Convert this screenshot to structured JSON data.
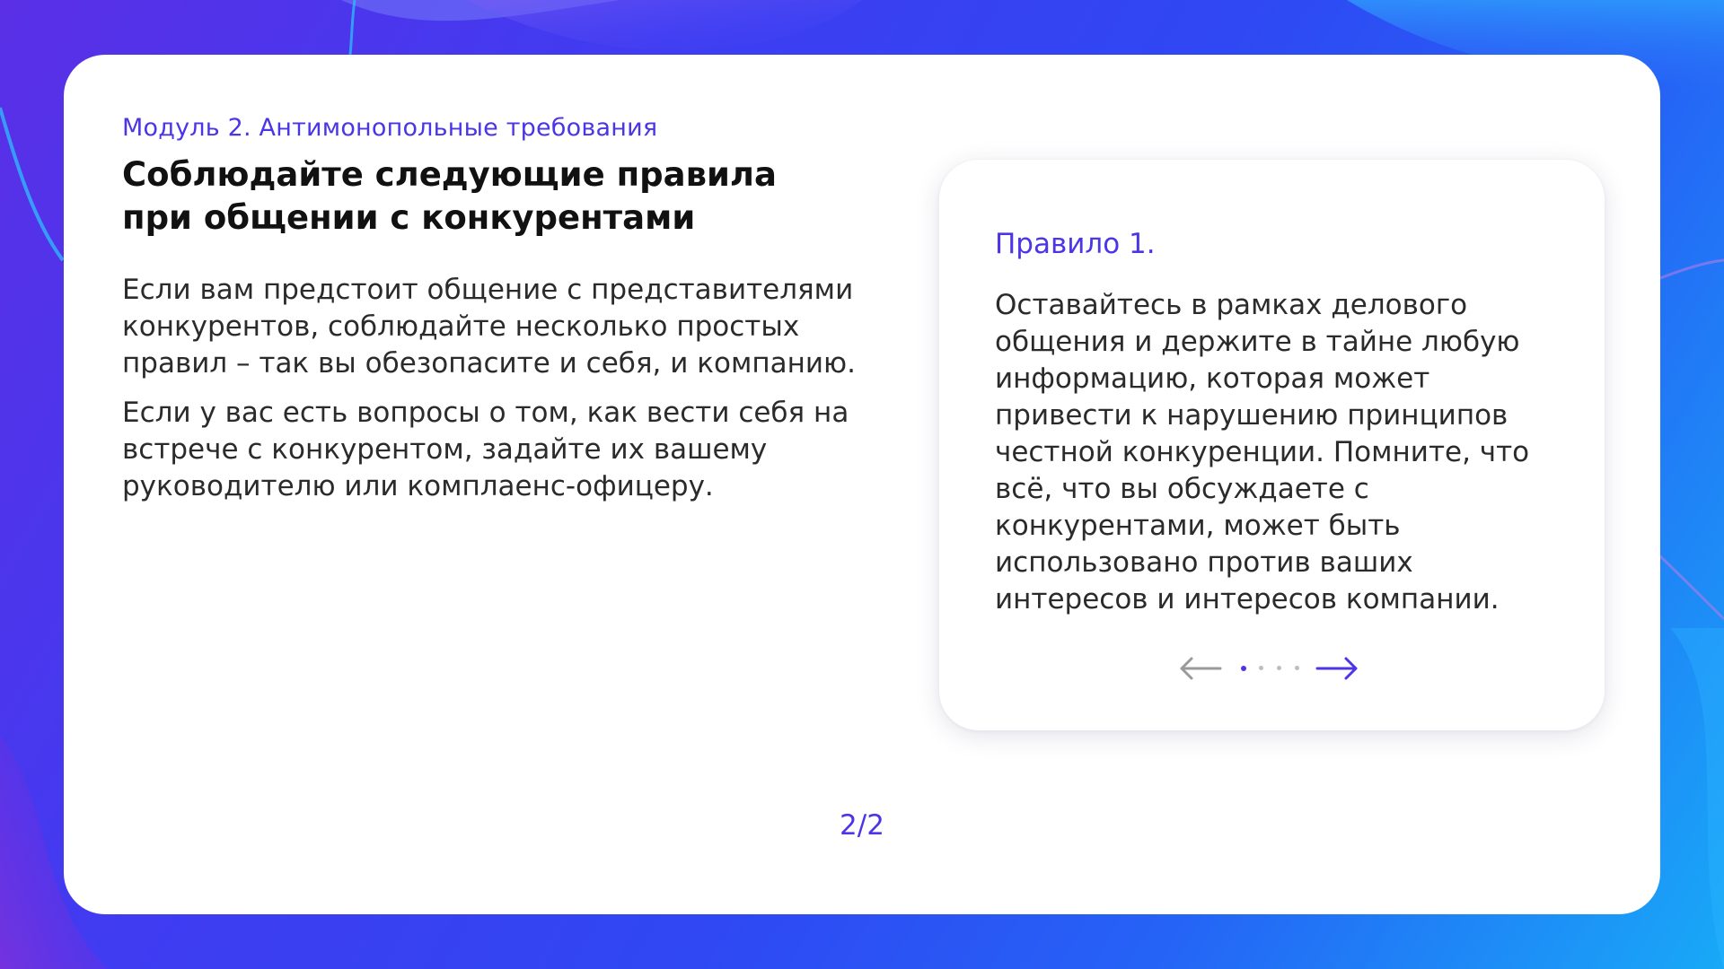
{
  "slide": {
    "module_label": "Модуль 2. Антимонопольные требования",
    "title": "Соблюдайте следующие правила при общении с конкурентами",
    "paragraphs": [
      "Если вам предстоит общение с представителями конкурентов, соблюдайте несколько простых правил – так вы обезопасите и себя, и компанию.",
      "Если у вас есть вопросы о том, как вести себя на встрече с конкурентом, задайте их вашему руководителю или комплаенс-офицеру."
    ],
    "page_indicator": "2/2"
  },
  "rule_card": {
    "title": "Правило 1.",
    "text": "Оставайтесь в рамках делового общения и держите в тайне любую информацию, которая может привести к нарушению принципов честной конкуренции. Помните, что всё, что вы обсуждаете с конкурентами, может быть использовано против ваших интересов и интересов компании.",
    "carousel": {
      "total": 4,
      "active_index": 0,
      "prev_icon": "arrow-left-icon",
      "next_icon": "arrow-right-icon"
    }
  },
  "colors": {
    "accent": "#4b35e6",
    "text": "#2b2b2b",
    "title": "#111111",
    "inactive": "#bdbdbd"
  }
}
